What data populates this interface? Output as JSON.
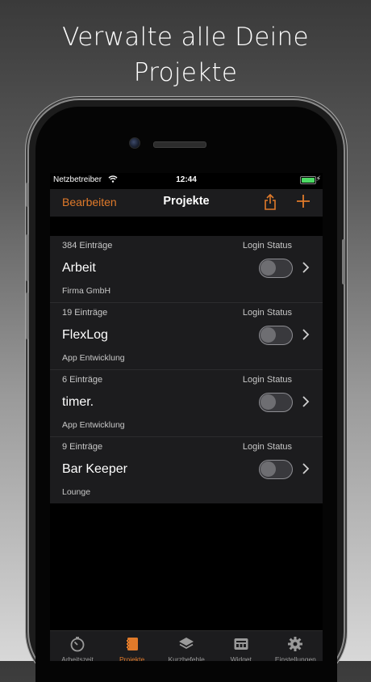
{
  "headline": {
    "line1": "Verwalte alle Deine",
    "line2": "Projekte"
  },
  "status_bar": {
    "carrier": "Netzbetreiber",
    "time": "12:44"
  },
  "nav": {
    "edit_label": "Bearbeiten",
    "title": "Projekte",
    "share_icon": "share-icon",
    "add_icon": "plus-icon"
  },
  "accent_color": "#e07a2a",
  "projects": [
    {
      "count": "384 Einträge",
      "status_label": "Login Status",
      "name": "Arbeit",
      "client": "Firma GmbH",
      "logged_in": false
    },
    {
      "count": "19 Einträge",
      "status_label": "Login Status",
      "name": "FlexLog",
      "client": "App Entwicklung",
      "logged_in": false
    },
    {
      "count": "6 Einträge",
      "status_label": "Login Status",
      "name": "timer.",
      "client": "App Entwicklung",
      "logged_in": false
    },
    {
      "count": "9 Einträge",
      "status_label": "Login Status",
      "name": "Bar Keeper",
      "client": "Lounge",
      "logged_in": false
    }
  ],
  "tabs": [
    {
      "label": "Arbeitszeit",
      "icon": "stopwatch-icon",
      "active": false
    },
    {
      "label": "Projekte",
      "icon": "book-icon",
      "active": true
    },
    {
      "label": "Kurzbefehle",
      "icon": "layers-icon",
      "active": false
    },
    {
      "label": "Widget",
      "icon": "widget-icon",
      "active": false
    },
    {
      "label": "Einstellungen",
      "icon": "gear-icon",
      "active": false
    }
  ]
}
